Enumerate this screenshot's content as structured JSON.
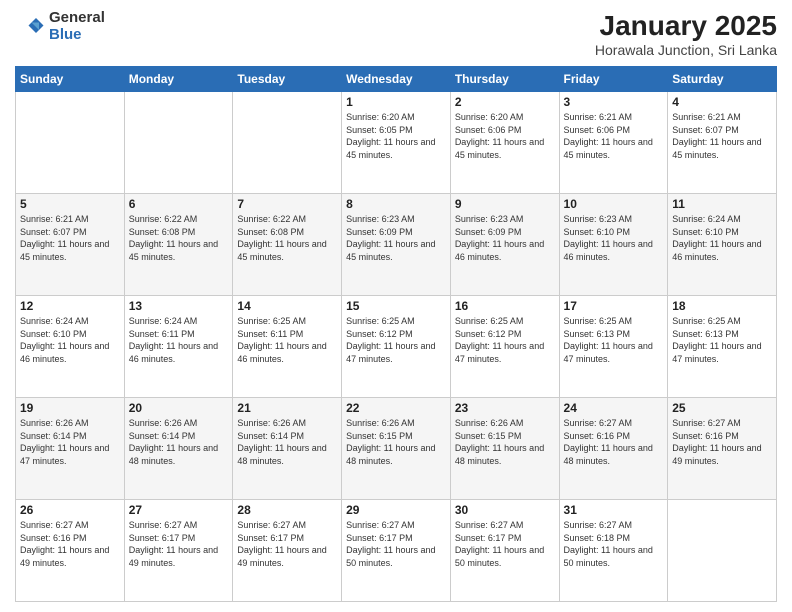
{
  "logo": {
    "general": "General",
    "blue": "Blue"
  },
  "header": {
    "title": "January 2025",
    "subtitle": "Horawala Junction, Sri Lanka"
  },
  "days_of_week": [
    "Sunday",
    "Monday",
    "Tuesday",
    "Wednesday",
    "Thursday",
    "Friday",
    "Saturday"
  ],
  "weeks": [
    [
      {
        "day": "",
        "info": ""
      },
      {
        "day": "",
        "info": ""
      },
      {
        "day": "",
        "info": ""
      },
      {
        "day": "1",
        "info": "Sunrise: 6:20 AM\nSunset: 6:05 PM\nDaylight: 11 hours and 45 minutes."
      },
      {
        "day": "2",
        "info": "Sunrise: 6:20 AM\nSunset: 6:06 PM\nDaylight: 11 hours and 45 minutes."
      },
      {
        "day": "3",
        "info": "Sunrise: 6:21 AM\nSunset: 6:06 PM\nDaylight: 11 hours and 45 minutes."
      },
      {
        "day": "4",
        "info": "Sunrise: 6:21 AM\nSunset: 6:07 PM\nDaylight: 11 hours and 45 minutes."
      }
    ],
    [
      {
        "day": "5",
        "info": "Sunrise: 6:21 AM\nSunset: 6:07 PM\nDaylight: 11 hours and 45 minutes."
      },
      {
        "day": "6",
        "info": "Sunrise: 6:22 AM\nSunset: 6:08 PM\nDaylight: 11 hours and 45 minutes."
      },
      {
        "day": "7",
        "info": "Sunrise: 6:22 AM\nSunset: 6:08 PM\nDaylight: 11 hours and 45 minutes."
      },
      {
        "day": "8",
        "info": "Sunrise: 6:23 AM\nSunset: 6:09 PM\nDaylight: 11 hours and 45 minutes."
      },
      {
        "day": "9",
        "info": "Sunrise: 6:23 AM\nSunset: 6:09 PM\nDaylight: 11 hours and 46 minutes."
      },
      {
        "day": "10",
        "info": "Sunrise: 6:23 AM\nSunset: 6:10 PM\nDaylight: 11 hours and 46 minutes."
      },
      {
        "day": "11",
        "info": "Sunrise: 6:24 AM\nSunset: 6:10 PM\nDaylight: 11 hours and 46 minutes."
      }
    ],
    [
      {
        "day": "12",
        "info": "Sunrise: 6:24 AM\nSunset: 6:10 PM\nDaylight: 11 hours and 46 minutes."
      },
      {
        "day": "13",
        "info": "Sunrise: 6:24 AM\nSunset: 6:11 PM\nDaylight: 11 hours and 46 minutes."
      },
      {
        "day": "14",
        "info": "Sunrise: 6:25 AM\nSunset: 6:11 PM\nDaylight: 11 hours and 46 minutes."
      },
      {
        "day": "15",
        "info": "Sunrise: 6:25 AM\nSunset: 6:12 PM\nDaylight: 11 hours and 47 minutes."
      },
      {
        "day": "16",
        "info": "Sunrise: 6:25 AM\nSunset: 6:12 PM\nDaylight: 11 hours and 47 minutes."
      },
      {
        "day": "17",
        "info": "Sunrise: 6:25 AM\nSunset: 6:13 PM\nDaylight: 11 hours and 47 minutes."
      },
      {
        "day": "18",
        "info": "Sunrise: 6:25 AM\nSunset: 6:13 PM\nDaylight: 11 hours and 47 minutes."
      }
    ],
    [
      {
        "day": "19",
        "info": "Sunrise: 6:26 AM\nSunset: 6:14 PM\nDaylight: 11 hours and 47 minutes."
      },
      {
        "day": "20",
        "info": "Sunrise: 6:26 AM\nSunset: 6:14 PM\nDaylight: 11 hours and 48 minutes."
      },
      {
        "day": "21",
        "info": "Sunrise: 6:26 AM\nSunset: 6:14 PM\nDaylight: 11 hours and 48 minutes."
      },
      {
        "day": "22",
        "info": "Sunrise: 6:26 AM\nSunset: 6:15 PM\nDaylight: 11 hours and 48 minutes."
      },
      {
        "day": "23",
        "info": "Sunrise: 6:26 AM\nSunset: 6:15 PM\nDaylight: 11 hours and 48 minutes."
      },
      {
        "day": "24",
        "info": "Sunrise: 6:27 AM\nSunset: 6:16 PM\nDaylight: 11 hours and 48 minutes."
      },
      {
        "day": "25",
        "info": "Sunrise: 6:27 AM\nSunset: 6:16 PM\nDaylight: 11 hours and 49 minutes."
      }
    ],
    [
      {
        "day": "26",
        "info": "Sunrise: 6:27 AM\nSunset: 6:16 PM\nDaylight: 11 hours and 49 minutes."
      },
      {
        "day": "27",
        "info": "Sunrise: 6:27 AM\nSunset: 6:17 PM\nDaylight: 11 hours and 49 minutes."
      },
      {
        "day": "28",
        "info": "Sunrise: 6:27 AM\nSunset: 6:17 PM\nDaylight: 11 hours and 49 minutes."
      },
      {
        "day": "29",
        "info": "Sunrise: 6:27 AM\nSunset: 6:17 PM\nDaylight: 11 hours and 50 minutes."
      },
      {
        "day": "30",
        "info": "Sunrise: 6:27 AM\nSunset: 6:17 PM\nDaylight: 11 hours and 50 minutes."
      },
      {
        "day": "31",
        "info": "Sunrise: 6:27 AM\nSunset: 6:18 PM\nDaylight: 11 hours and 50 minutes."
      },
      {
        "day": "",
        "info": ""
      }
    ]
  ],
  "colors": {
    "header_bg": "#2a6db5",
    "accent": "#2a6db5"
  }
}
